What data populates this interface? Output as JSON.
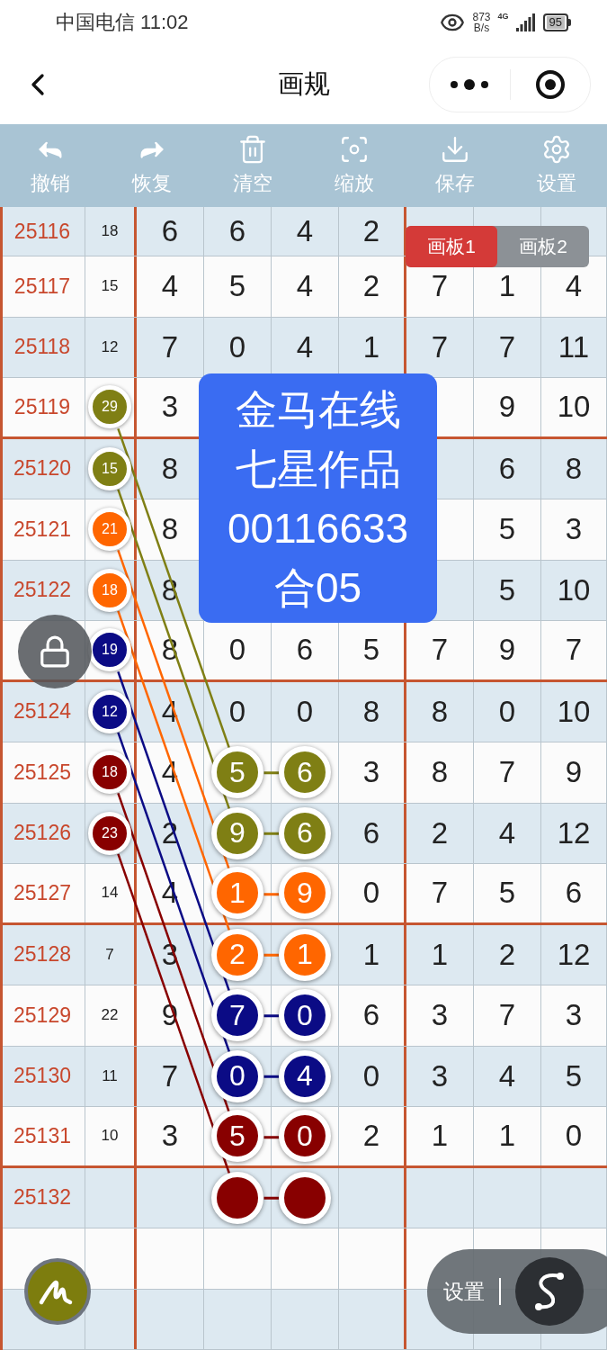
{
  "status_bar": {
    "carrier_time": "中国电信 11:02",
    "speed_value": "873",
    "speed_unit": "B/s",
    "network": "4G",
    "battery": "95"
  },
  "nav": {
    "title": "画规"
  },
  "toolbar": [
    {
      "kind": "undo",
      "label": "撤销"
    },
    {
      "kind": "redo",
      "label": "恢复"
    },
    {
      "kind": "clear",
      "label": "清空"
    },
    {
      "kind": "zoom",
      "label": "缩放"
    },
    {
      "kind": "save",
      "label": "保存"
    },
    {
      "kind": "settings",
      "label": "设置"
    }
  ],
  "board_tabs": [
    {
      "label": "画板1",
      "selected": true
    },
    {
      "label": "画板2",
      "selected": false
    }
  ],
  "rows": [
    {
      "period": "25116",
      "sum": {
        "text": "18"
      },
      "digits": [
        {
          "kind": "number",
          "text": "6"
        },
        {
          "kind": "number",
          "text": "6"
        },
        {
          "kind": "number",
          "text": "4"
        },
        {
          "kind": "number",
          "text": "2"
        },
        {
          "kind": "blank"
        },
        {
          "kind": "blank"
        },
        {
          "kind": "blank"
        }
      ]
    },
    {
      "period": "25117",
      "sum": {
        "text": "15"
      },
      "digits": [
        {
          "kind": "number",
          "text": "4"
        },
        {
          "kind": "number",
          "text": "5"
        },
        {
          "kind": "number",
          "text": "4"
        },
        {
          "kind": "number",
          "text": "2"
        },
        {
          "kind": "number",
          "text": "7"
        },
        {
          "kind": "number",
          "text": "1"
        },
        {
          "kind": "number",
          "text": "4"
        }
      ]
    },
    {
      "period": "25118",
      "sum": {
        "text": "12"
      },
      "digits": [
        {
          "kind": "number",
          "text": "7"
        },
        {
          "kind": "number",
          "text": "0"
        },
        {
          "kind": "number",
          "text": "4"
        },
        {
          "kind": "number",
          "text": "1"
        },
        {
          "kind": "number",
          "text": "7"
        },
        {
          "kind": "number",
          "text": "7"
        },
        {
          "kind": "number",
          "text": "11"
        }
      ]
    },
    {
      "period": "25119",
      "sum": {
        "text": "29",
        "color": "#7f7f14"
      },
      "digits": [
        {
          "kind": "number",
          "text": "3"
        },
        {
          "kind": "blank"
        },
        {
          "kind": "blank"
        },
        {
          "kind": "blank"
        },
        {
          "kind": "blank"
        },
        {
          "kind": "number",
          "text": "9"
        },
        {
          "kind": "number",
          "text": "10"
        }
      ]
    },
    {
      "period": "25120",
      "sum": {
        "text": "15",
        "color": "#7f7f14"
      },
      "digits": [
        {
          "kind": "number",
          "text": "8"
        },
        {
          "kind": "blank"
        },
        {
          "kind": "blank"
        },
        {
          "kind": "blank"
        },
        {
          "kind": "blank"
        },
        {
          "kind": "number",
          "text": "6"
        },
        {
          "kind": "number",
          "text": "8"
        }
      ]
    },
    {
      "period": "25121",
      "sum": {
        "text": "21",
        "color": "#ff6600"
      },
      "digits": [
        {
          "kind": "number",
          "text": "8"
        },
        {
          "kind": "blank"
        },
        {
          "kind": "blank"
        },
        {
          "kind": "blank"
        },
        {
          "kind": "blank"
        },
        {
          "kind": "number",
          "text": "5"
        },
        {
          "kind": "number",
          "text": "3"
        }
      ]
    },
    {
      "period": "25122",
      "sum": {
        "text": "18",
        "color": "#ff6600"
      },
      "digits": [
        {
          "kind": "number",
          "text": "8"
        },
        {
          "kind": "blank"
        },
        {
          "kind": "blank"
        },
        {
          "kind": "blank"
        },
        {
          "kind": "blank"
        },
        {
          "kind": "number",
          "text": "5"
        },
        {
          "kind": "number",
          "text": "10"
        }
      ]
    },
    {
      "sum": {
        "text": "19",
        "color": "#0b0b85"
      },
      "digits": [
        {
          "kind": "number",
          "text": "8"
        },
        {
          "kind": "number",
          "text": "0"
        },
        {
          "kind": "number",
          "text": "6"
        },
        {
          "kind": "number",
          "text": "5"
        },
        {
          "kind": "number",
          "text": "7"
        },
        {
          "kind": "number",
          "text": "9"
        },
        {
          "kind": "number",
          "text": "7"
        }
      ]
    },
    {
      "period": "25124",
      "sum": {
        "text": "12",
        "color": "#0b0b85"
      },
      "digits": [
        {
          "kind": "number",
          "text": "4"
        },
        {
          "kind": "number",
          "text": "0"
        },
        {
          "kind": "number",
          "text": "0"
        },
        {
          "kind": "number",
          "text": "8"
        },
        {
          "kind": "number",
          "text": "8"
        },
        {
          "kind": "number",
          "text": "0"
        },
        {
          "kind": "number",
          "text": "10"
        }
      ]
    },
    {
      "period": "25125",
      "sum": {
        "text": "18",
        "color": "#880000"
      },
      "digits": [
        {
          "kind": "number",
          "text": "4"
        },
        {
          "kind": "ball",
          "text": "5",
          "color": "#7f7f14"
        },
        {
          "kind": "ball",
          "text": "6",
          "color": "#7f7f14"
        },
        {
          "kind": "number",
          "text": "3"
        },
        {
          "kind": "number",
          "text": "8"
        },
        {
          "kind": "number",
          "text": "7"
        },
        {
          "kind": "number",
          "text": "9"
        }
      ]
    },
    {
      "period": "25126",
      "sum": {
        "text": "23",
        "color": "#880000"
      },
      "digits": [
        {
          "kind": "number",
          "text": "2"
        },
        {
          "kind": "ball",
          "text": "9",
          "color": "#7f7f14"
        },
        {
          "kind": "ball",
          "text": "6",
          "color": "#7f7f14"
        },
        {
          "kind": "number",
          "text": "6"
        },
        {
          "kind": "number",
          "text": "2"
        },
        {
          "kind": "number",
          "text": "4"
        },
        {
          "kind": "number",
          "text": "12"
        }
      ]
    },
    {
      "period": "25127",
      "sum": {
        "text": "14"
      },
      "digits": [
        {
          "kind": "number",
          "text": "4"
        },
        {
          "kind": "ball",
          "text": "1",
          "color": "#ff6600"
        },
        {
          "kind": "ball",
          "text": "9",
          "color": "#ff6600"
        },
        {
          "kind": "number",
          "text": "0"
        },
        {
          "kind": "number",
          "text": "7"
        },
        {
          "kind": "number",
          "text": "5"
        },
        {
          "kind": "number",
          "text": "6"
        }
      ]
    },
    {
      "period": "25128",
      "sum": {
        "text": "7"
      },
      "digits": [
        {
          "kind": "number",
          "text": "3"
        },
        {
          "kind": "ball",
          "text": "2",
          "color": "#ff6600"
        },
        {
          "kind": "ball",
          "text": "1",
          "color": "#ff6600"
        },
        {
          "kind": "number",
          "text": "1"
        },
        {
          "kind": "number",
          "text": "1"
        },
        {
          "kind": "number",
          "text": "2"
        },
        {
          "kind": "number",
          "text": "12"
        }
      ]
    },
    {
      "period": "25129",
      "sum": {
        "text": "22"
      },
      "digits": [
        {
          "kind": "number",
          "text": "9"
        },
        {
          "kind": "ball",
          "text": "7",
          "color": "#0b0b85"
        },
        {
          "kind": "ball",
          "text": "0",
          "color": "#0b0b85"
        },
        {
          "kind": "number",
          "text": "6"
        },
        {
          "kind": "number",
          "text": "3"
        },
        {
          "kind": "number",
          "text": "7"
        },
        {
          "kind": "number",
          "text": "3"
        }
      ]
    },
    {
      "period": "25130",
      "sum": {
        "text": "11"
      },
      "digits": [
        {
          "kind": "number",
          "text": "7"
        },
        {
          "kind": "ball",
          "text": "0",
          "color": "#0b0b85"
        },
        {
          "kind": "ball",
          "text": "4",
          "color": "#0b0b85"
        },
        {
          "kind": "number",
          "text": "0"
        },
        {
          "kind": "number",
          "text": "3"
        },
        {
          "kind": "number",
          "text": "4"
        },
        {
          "kind": "number",
          "text": "5"
        }
      ]
    },
    {
      "period": "25131",
      "sum": {
        "text": "10"
      },
      "digits": [
        {
          "kind": "number",
          "text": "3"
        },
        {
          "kind": "ball",
          "text": "5",
          "color": "#880000"
        },
        {
          "kind": "ball",
          "text": "0",
          "color": "#880000"
        },
        {
          "kind": "number",
          "text": "2"
        },
        {
          "kind": "number",
          "text": "1"
        },
        {
          "kind": "number",
          "text": "1"
        },
        {
          "kind": "number",
          "text": "0"
        }
      ]
    },
    {
      "period": "25132",
      "digits": [
        {
          "kind": "blank"
        },
        {
          "kind": "ball",
          "color": "#880000"
        },
        {
          "kind": "ball",
          "color": "#880000"
        },
        {
          "kind": "blank"
        },
        {
          "kind": "blank"
        },
        {
          "kind": "blank"
        },
        {
          "kind": "blank"
        }
      ]
    },
    {},
    {}
  ],
  "popup": {
    "lines": [
      "金马在线",
      "七星作品",
      "00116633",
      "合05"
    ]
  },
  "settings_pill": {
    "label": "设置"
  }
}
